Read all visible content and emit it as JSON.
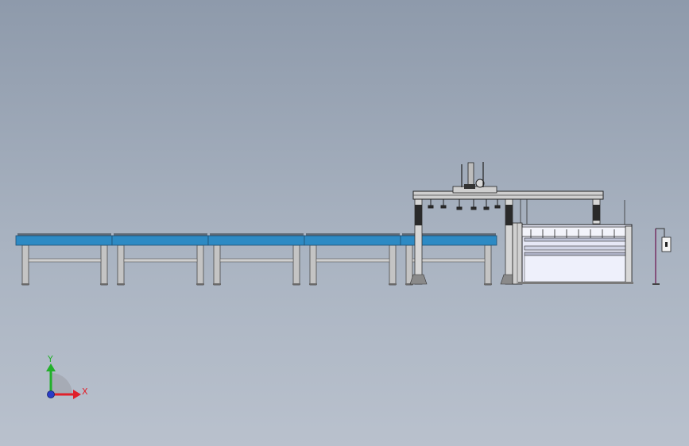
{
  "viewport": {
    "background_top": "#8e9aab",
    "background_bottom": "#b9c1cd"
  },
  "triad": {
    "x_label": "X",
    "y_label": "Y",
    "x_color": "#e0202a",
    "y_color": "#22b02a",
    "z_color": "#2a3cc8"
  },
  "model": {
    "conveyor_color": "#2d8ac4",
    "frame_color": "#c8c8c8",
    "cutter_panel_color": "#e6e8f6"
  }
}
